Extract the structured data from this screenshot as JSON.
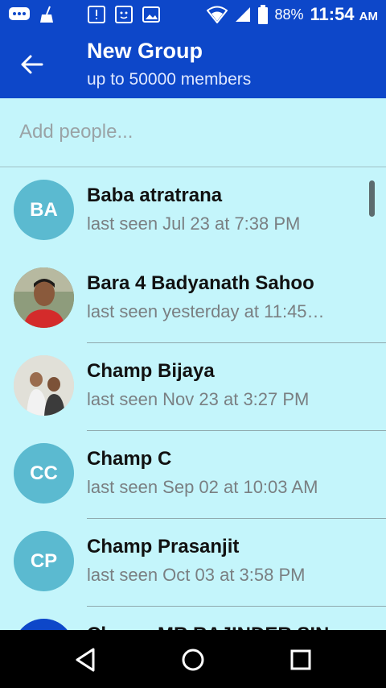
{
  "status_bar": {
    "battery": "88%",
    "time": "11:54",
    "ampm": "AM"
  },
  "header": {
    "title": "New Group",
    "subtitle": "up to 50000 members"
  },
  "search": {
    "placeholder": "Add people..."
  },
  "contacts": [
    {
      "initials": "BA",
      "name": "Baba atratrana",
      "status": "last seen Jul 23 at 7:38 PM",
      "avatar_type": "initials"
    },
    {
      "initials": "",
      "name": "Bara 4 Badyanath Sahoo",
      "status": "last seen yesterday at 11:45…",
      "avatar_type": "photo"
    },
    {
      "initials": "",
      "name": "Champ Bijaya",
      "status": "last seen Nov 23 at 3:27 PM",
      "avatar_type": "photo"
    },
    {
      "initials": "CC",
      "name": "Champ C",
      "status": "last seen Sep 02 at 10:03 AM",
      "avatar_type": "initials"
    },
    {
      "initials": "CP",
      "name": "Champ Prasanjit",
      "status": "last seen Oct 03 at 3:58 PM",
      "avatar_type": "initials"
    },
    {
      "initials": "",
      "name": "Champ MR RAJINDER SIN",
      "status": "",
      "avatar_type": "initials"
    }
  ],
  "colors": {
    "primary": "#0d47c9",
    "background": "#c4f5fb",
    "avatar": "#5bbad0"
  }
}
